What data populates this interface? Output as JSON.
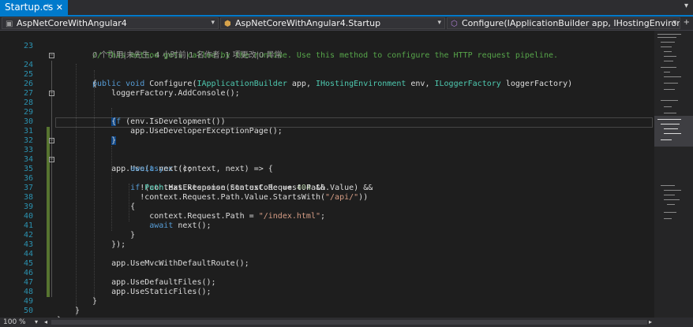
{
  "tab": {
    "title": "Startup.cs",
    "pin_icon": "pin-icon",
    "close_icon": "close-icon"
  },
  "nav": {
    "project": "AspNetCoreWithAngular4",
    "class": "AspNetCoreWithAngular4.Startup",
    "member": "Configure(IApplicationBuilder app, IHostingEnvironment env, ILoggerFactory loggerFactory)"
  },
  "code": {
    "comment": "// This method gets called by the runtime. Use this method to configure the HTTP request pipeline.",
    "lens": "0 个引用|未先生, 4 小时前|1 名作者, 1 项更改|0 异常",
    "line_numbers": [
      "23",
      "24",
      "25",
      "26",
      "27",
      "28",
      "29",
      "30",
      "31",
      "32",
      "33",
      "34",
      "35",
      "36",
      "37",
      "38",
      "39",
      "40",
      "41",
      "42",
      "43",
      "44",
      "45",
      "46",
      "47",
      "48",
      "49",
      "50"
    ]
  },
  "status": {
    "zoom": "100 %"
  },
  "colors": {
    "accent": "#007acc",
    "keyword": "#569cd6",
    "type": "#4ec9b0",
    "string": "#d69d85",
    "comment": "#57a64a",
    "linenumber": "#2b91af"
  }
}
